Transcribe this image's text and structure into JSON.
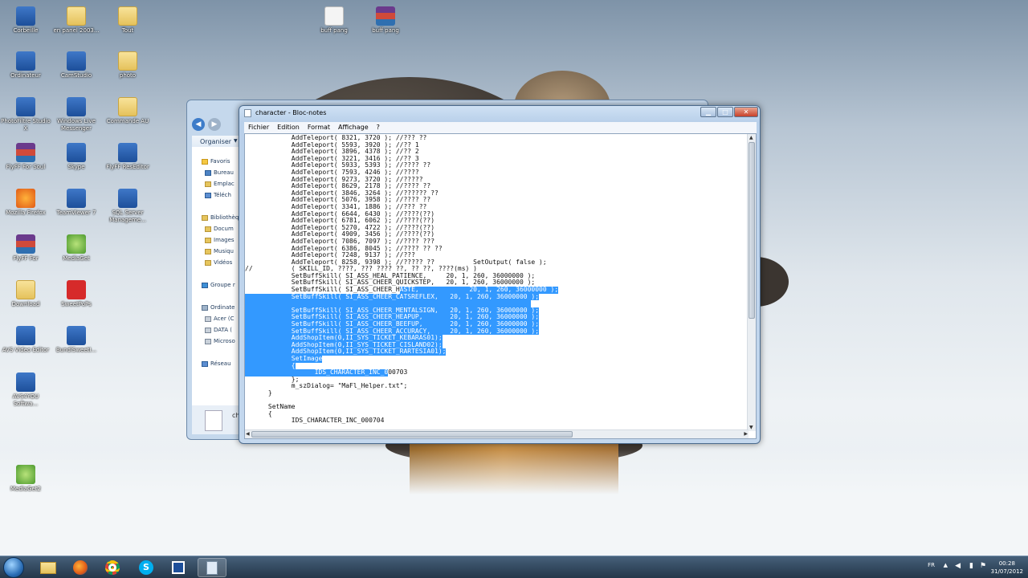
{
  "desktop": {
    "icons": [
      {
        "label": "Corbeille",
        "icon": "recycle-bin-icon"
      },
      {
        "label": "en panel 2003...",
        "icon": "folder-icon"
      },
      {
        "label": "Tout",
        "icon": "folder-icon"
      },
      {
        "label": "Ordinateur",
        "icon": "computer-icon"
      },
      {
        "label": "CamStudio",
        "icon": "camstudio-icon"
      },
      {
        "label": "photo",
        "icon": "folder-icon"
      },
      {
        "label": "PhotoFiltre Studio X",
        "icon": "photofiltre-icon"
      },
      {
        "label": "Windows Live Messenger",
        "icon": "messenger-icon"
      },
      {
        "label": "Commande AU",
        "icon": "folder-icon"
      },
      {
        "label": "FlyFF For Soul",
        "icon": "rar-icon"
      },
      {
        "label": "Skype",
        "icon": "skype-icon"
      },
      {
        "label": "FlyFF ResEditor",
        "icon": "reseditor-icon"
      },
      {
        "label": "Mozilla Firefox",
        "icon": "firefox-icon"
      },
      {
        "label": "TeamViewer 7",
        "icon": "teamviewer-icon"
      },
      {
        "label": "SQL Server Manageme...",
        "icon": "sql-server-icon"
      },
      {
        "label": "FlyFF For",
        "icon": "rar-icon"
      },
      {
        "label": "MediaGet",
        "icon": "mediaget-icon"
      },
      {
        "label": "Download",
        "icon": "folder-icon"
      },
      {
        "label": "SweetPoPs",
        "icon": "sweetpops-icon"
      },
      {
        "label": "AVS Video Editor",
        "icon": "avs-video-editor-icon"
      },
      {
        "label": "BundlSweetI...",
        "icon": "bundle-icon"
      },
      {
        "label": "AVS4YOU Softwa...",
        "icon": "avs4you-icon"
      },
      {
        "label": "MediaGet2",
        "icon": "mediaget-icon"
      },
      {
        "label": "buff pang",
        "icon": "document-icon"
      },
      {
        "label": "buff pang",
        "icon": "rar-icon"
      }
    ]
  },
  "explorer": {
    "toolbar_label": "Organiser",
    "nav": [
      "Favoris",
      "Bureau",
      "Emplac",
      "Téléch",
      "Bibliothèq",
      "Docum",
      "Images",
      "Musiqu",
      "Vidéos",
      "Groupe r",
      "Ordinate",
      "Acer (C",
      "DATA (",
      "Microso",
      "Réseau"
    ],
    "file_label": "ch"
  },
  "notepad": {
    "title": "character - Bloc-notes",
    "menu": [
      "Fichier",
      "Edition",
      "Format",
      "Affichage",
      "?"
    ],
    "lines": [
      {
        "text": "            AddTeleport( 8321, 3720 ); //??? ??"
      },
      {
        "text": "            AddTeleport( 5593, 3920 ); //?? 1"
      },
      {
        "text": "            AddTeleport( 3896, 4378 ); //?? 2"
      },
      {
        "text": "            AddTeleport( 3221, 3416 ); //?? 3"
      },
      {
        "text": "            AddTeleport( 5933, 5393 ); //???? ??"
      },
      {
        "text": "            AddTeleport( 7593, 4246 ); //????"
      },
      {
        "text": "            AddTeleport( 9273, 3720 ); //?????"
      },
      {
        "text": "            AddTeleport( 8629, 2178 ); //???? ??"
      },
      {
        "text": "            AddTeleport( 3846, 3264 ); //?????? ??"
      },
      {
        "text": "            AddTeleport( 5076, 3958 ); //???? ??"
      },
      {
        "text": "            AddTeleport( 3341, 1886 ); //??? ??"
      },
      {
        "text": "            AddTeleport( 6644, 6430 ); //????(??)"
      },
      {
        "text": "            AddTeleport( 6781, 6062 ); //????(??)"
      },
      {
        "text": "            AddTeleport( 5270, 4722 ); //????(??)"
      },
      {
        "text": "            AddTeleport( 4909, 3456 ); //????(??)"
      },
      {
        "text": "            AddTeleport( 7086, 7097 ); //???? ???"
      },
      {
        "text": "            AddTeleport( 6386, 8045 ); //???? ?? ??"
      },
      {
        "text": "            AddTeleport( 7248, 9137 ); //???"
      },
      {
        "text": "            AddTeleport( 8258, 9398 ); //????? ??          SetOutput( false );"
      },
      {
        "text": "//          ( SKILL_ID, ????, ??? ???? ??, ?? ??, ????(ms) )"
      },
      {
        "text": "            SetBuffSkill( SI_ASS_HEAL_PATIENCE,     20, 1, 260, 36000000 );"
      },
      {
        "text": "            SetBuffSkill( SI_ASS_CHEER_QUICKSTEP,   20, 1, 260, 36000000 );"
      },
      {
        "pre": "            SetBuffSkill( SI_ASS_CHEER_H",
        "hl": "ASTE,             20, 1, 260, 36000000 );"
      },
      {
        "pre": "",
        "hl": "            SetBuffSkill( SI_ASS_CHEER_CATSREFLEX,   20, 1, 260, 36000000 );"
      },
      {
        "pre": "",
        "hl": "                                                                          "
      },
      {
        "pre": "",
        "hl": "            SetBuffSkill( SI_ASS_CHEER_MENTALSIGN,   20, 1, 260, 36000000 );"
      },
      {
        "pre": "",
        "hl": "            SetBuffSkill( SI_ASS_CHEER_HEAPUP,       20, 1, 260, 36000000 );"
      },
      {
        "pre": "",
        "hl": "            SetBuffSkill( SI_ASS_CHEER_BEEFUP,       20, 1, 260, 36000000 );"
      },
      {
        "pre": "",
        "hl": "            SetBuffSkill( SI_ASS_CHEER_ACCURACY,     20, 1, 260, 36000000 );"
      },
      {
        "pre": "",
        "hl": "            AddShopItem(0,II_SYS_TICKET_KEBARAS01);"
      },
      {
        "pre": "",
        "hl": "            AddShopItem(0,II_SYS_TICKET_CISLAND02);"
      },
      {
        "pre": "",
        "hl": "            AddShopItem(0,II_SYS_TICKET_RARTESIA01);"
      },
      {
        "pre": "",
        "hl": "            SetImage"
      },
      {
        "pre": "",
        "hl": "            {"
      },
      {
        "pre": "",
        "hl": "                  IDS_CHARACTER_INC_0",
        "post": "00703"
      },
      {
        "text": "            };"
      },
      {
        "text": "            m_szDialog= \"MaFl_Helper.txt\";"
      },
      {
        "text": "      }"
      },
      {
        "text": ""
      },
      {
        "text": "      SetName"
      },
      {
        "text": "      {"
      },
      {
        "text": "            IDS_CHARACTER_INC_000704"
      }
    ]
  },
  "taskbar": {
    "apps": [
      {
        "name": "explorer",
        "icon": "folder-icon"
      },
      {
        "name": "firefox",
        "icon": "firefox-icon"
      },
      {
        "name": "chrome",
        "icon": "chrome-icon"
      },
      {
        "name": "skype",
        "icon": "skype-icon"
      },
      {
        "name": "camstudio",
        "icon": "camstudio-icon"
      },
      {
        "name": "notepad",
        "icon": "notepad-icon"
      }
    ],
    "lang": "FR",
    "time": "00:28",
    "date": "31/07/2012"
  }
}
